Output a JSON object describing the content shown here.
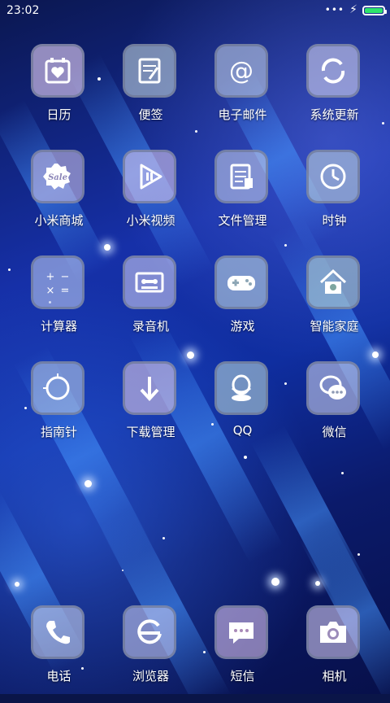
{
  "status": {
    "time": "23:02",
    "signal_dots": "•••",
    "charging_icon": "lightning-icon",
    "battery_level": 1.0,
    "battery_color": "#2ee66b"
  },
  "apps": [
    {
      "label": "日历",
      "icon": "calendar-icon"
    },
    {
      "label": "便签",
      "icon": "notes-icon"
    },
    {
      "label": "电子邮件",
      "icon": "email-icon"
    },
    {
      "label": "系统更新",
      "icon": "update-icon"
    },
    {
      "label": "小米商城",
      "icon": "store-icon"
    },
    {
      "label": "小米视频",
      "icon": "video-icon"
    },
    {
      "label": "文件管理",
      "icon": "files-icon"
    },
    {
      "label": "时钟",
      "icon": "clock-icon"
    },
    {
      "label": "计算器",
      "icon": "calculator-icon"
    },
    {
      "label": "录音机",
      "icon": "recorder-icon"
    },
    {
      "label": "游戏",
      "icon": "game-icon"
    },
    {
      "label": "智能家庭",
      "icon": "smarthome-icon"
    },
    {
      "label": "指南针",
      "icon": "compass-icon"
    },
    {
      "label": "下载管理",
      "icon": "download-icon"
    },
    {
      "label": "QQ",
      "icon": "qq-icon"
    },
    {
      "label": "微信",
      "icon": "wechat-icon"
    }
  ],
  "dock": [
    {
      "label": "电话",
      "icon": "phone-icon"
    },
    {
      "label": "浏览器",
      "icon": "browser-icon"
    },
    {
      "label": "短信",
      "icon": "message-icon"
    },
    {
      "label": "相机",
      "icon": "camera-icon"
    }
  ],
  "sale_text": "Sale"
}
